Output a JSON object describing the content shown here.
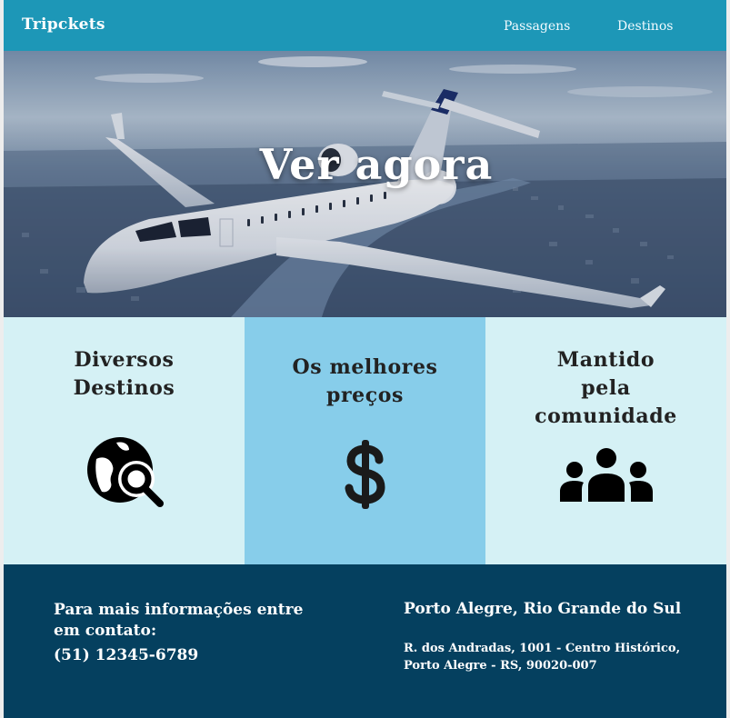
{
  "nav": {
    "brand": "Tripckets",
    "links": [
      "Passagens",
      "Destinos"
    ]
  },
  "hero": {
    "title": "Ver agora",
    "image": "airplane-over-city-photo"
  },
  "features": [
    {
      "title": "Diversos Destinos",
      "icon": "globe-search-icon"
    },
    {
      "title": "Os melhores preços",
      "icon": "dollar-sign-icon"
    },
    {
      "title": "Mantido pela comunidade",
      "icon": "people-group-icon"
    }
  ],
  "footer": {
    "contact_heading": "Para mais informações entre em contato:",
    "phone": "(51) 12345-6789",
    "city": "Porto Alegre, Rio Grande do Sul",
    "address": "R. dos Andradas, 1001 - Centro Histórico, Porto Alegre - RS, 90020-007"
  },
  "colors": {
    "nav": "#1d97b7",
    "feature_light": "#d5f1f5",
    "feature_mid": "#87cdea",
    "footer": "#05405f"
  }
}
